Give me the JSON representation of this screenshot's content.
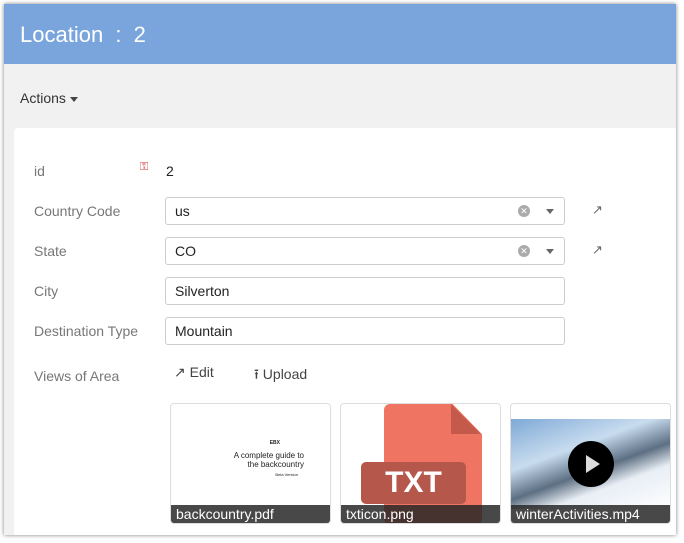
{
  "header": {
    "title": "Location",
    "separator": ":",
    "record_id": "2"
  },
  "toolbar": {
    "actions_label": "Actions"
  },
  "form": {
    "id": {
      "label": "id",
      "value": "2"
    },
    "country_code": {
      "label": "Country Code",
      "value": "us"
    },
    "state": {
      "label": "State",
      "value": "CO"
    },
    "city": {
      "label": "City",
      "value": "Silverton"
    },
    "destination_type": {
      "label": "Destination Type",
      "value": "Mountain"
    },
    "views": {
      "label": "Views of Area",
      "edit_label": "Edit",
      "upload_label": "Upload"
    }
  },
  "attachments": [
    {
      "name": "backcountry.pdf",
      "preview": {
        "brand": "EBX",
        "title_line1": "A complete guide to",
        "title_line2": "the backcountry",
        "subtitle": "Beta Version"
      }
    },
    {
      "name": "txticon.png",
      "preview": {
        "badge": "TXT"
      }
    },
    {
      "name": "winterActivities.mp4"
    }
  ],
  "colors": {
    "header": "#7aa5dc",
    "txt_icon": "#f07462"
  }
}
